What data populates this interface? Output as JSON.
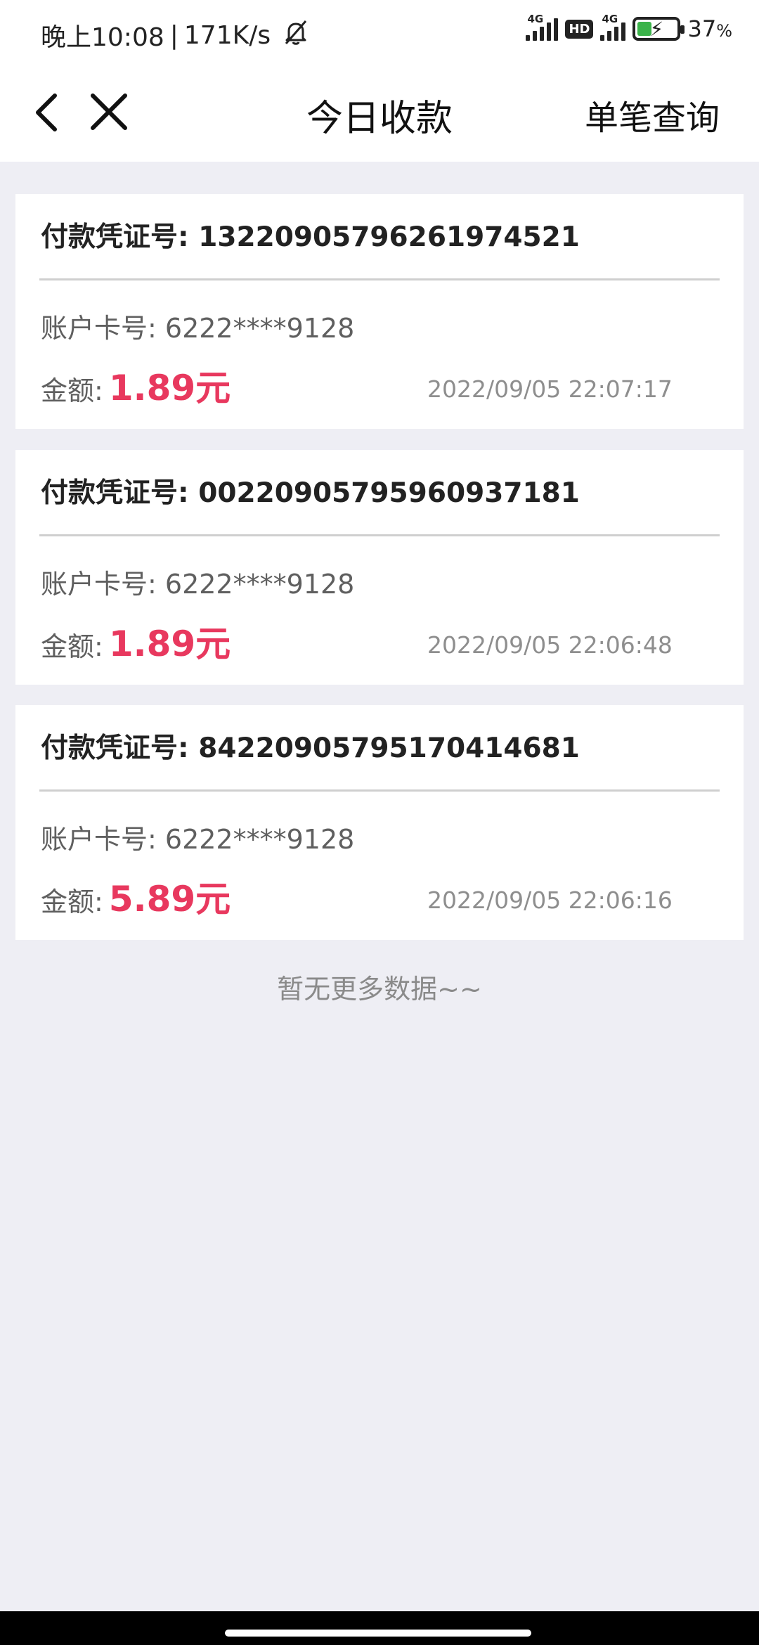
{
  "status_bar": {
    "time": "晚上10:08",
    "separator": "|",
    "net_speed": "171K/s",
    "network1": "4G",
    "hd_badge": "HD",
    "network2": "4G",
    "battery": "37",
    "battery_unit": "%"
  },
  "nav": {
    "title": "今日收款",
    "action": "单笔查询"
  },
  "labels": {
    "voucher": "付款凭证号:",
    "account": "账户卡号:",
    "amount": "金额:"
  },
  "records": [
    {
      "voucher_no": "13220905796261974521",
      "account_no": "6222****9128",
      "amount": "1.89元",
      "time": "2022/09/05 22:07:17"
    },
    {
      "voucher_no": "00220905795960937181",
      "account_no": "6222****9128",
      "amount": "1.89元",
      "time": "2022/09/05 22:06:48"
    },
    {
      "voucher_no": "84220905795170414681",
      "account_no": "6222****9128",
      "amount": "5.89元",
      "time": "2022/09/05 22:06:16"
    }
  ],
  "footer": {
    "no_more": "暂无更多数据~~"
  },
  "colors": {
    "amount": "#e8385e",
    "background": "#eeeef4",
    "card": "#ffffff"
  }
}
